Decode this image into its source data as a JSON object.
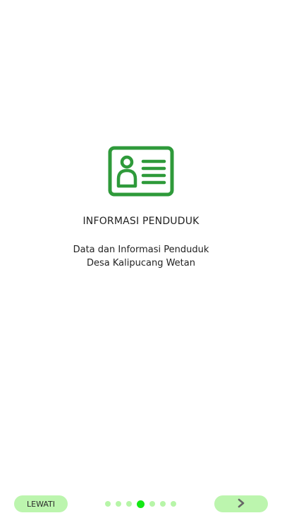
{
  "onboarding": {
    "icon": "id-card-icon",
    "title": "INFORMASI PENDUDUK",
    "description_lines": [
      "Data dan Informasi Penduduk",
      "Desa Kalipucang Wetan"
    ]
  },
  "footer": {
    "skip_label": "LEWATI",
    "next_icon": "chevron-right-icon",
    "pagination": {
      "total": 7,
      "current": 4
    }
  },
  "colors": {
    "icon_green": "#2e9a3a",
    "button_bg": "#bcf5ae",
    "dot_inactive": "#b7f5a8",
    "dot_active": "#14e814",
    "chevron": "#666666"
  }
}
